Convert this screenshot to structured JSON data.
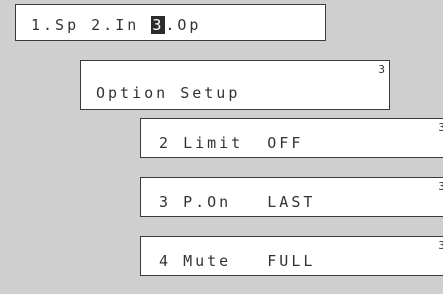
{
  "main_menu": {
    "item1": "1.Sp",
    "item2": "2.In",
    "item3_number": "3",
    "item3_rest": ".Op"
  },
  "option_setup": {
    "title": "Option Setup",
    "page": "3"
  },
  "options": [
    {
      "number": "2",
      "name": "Limit",
      "value": "OFF",
      "page": "3"
    },
    {
      "number": "3",
      "name": "P.On",
      "value": "LAST",
      "page": "3"
    },
    {
      "number": "4",
      "name": "Mute",
      "value": "FULL",
      "page": "3"
    }
  ]
}
